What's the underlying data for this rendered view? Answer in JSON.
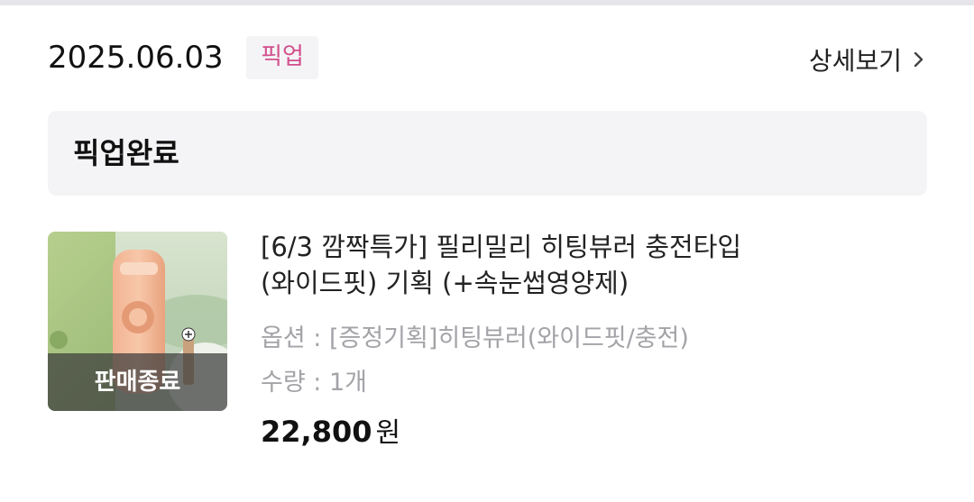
{
  "order": {
    "date": "2025.06.03",
    "type_badge": "픽업",
    "detail_link": "상세보기",
    "status": "픽업완료"
  },
  "product": {
    "title_line1": "[6/3 깜짝특가] 필리밀리 히팅뷰러 충전타입",
    "title_line2": "(와이드핏) 기획 (+속눈썹영양제)",
    "option": "옵션 : [증정기획]히팅뷰러(와이드핏/충전)",
    "quantity": "수량 : 1개",
    "price": "22,800",
    "currency": "원",
    "soldout_label": "판매종료",
    "image_icon": "product-thumbnail-image"
  },
  "colors": {
    "badge_text": "#d24f8c",
    "badge_bg": "#f4f4f6",
    "status_bg": "#f4f4f6",
    "muted_text": "#a3a3a8"
  }
}
